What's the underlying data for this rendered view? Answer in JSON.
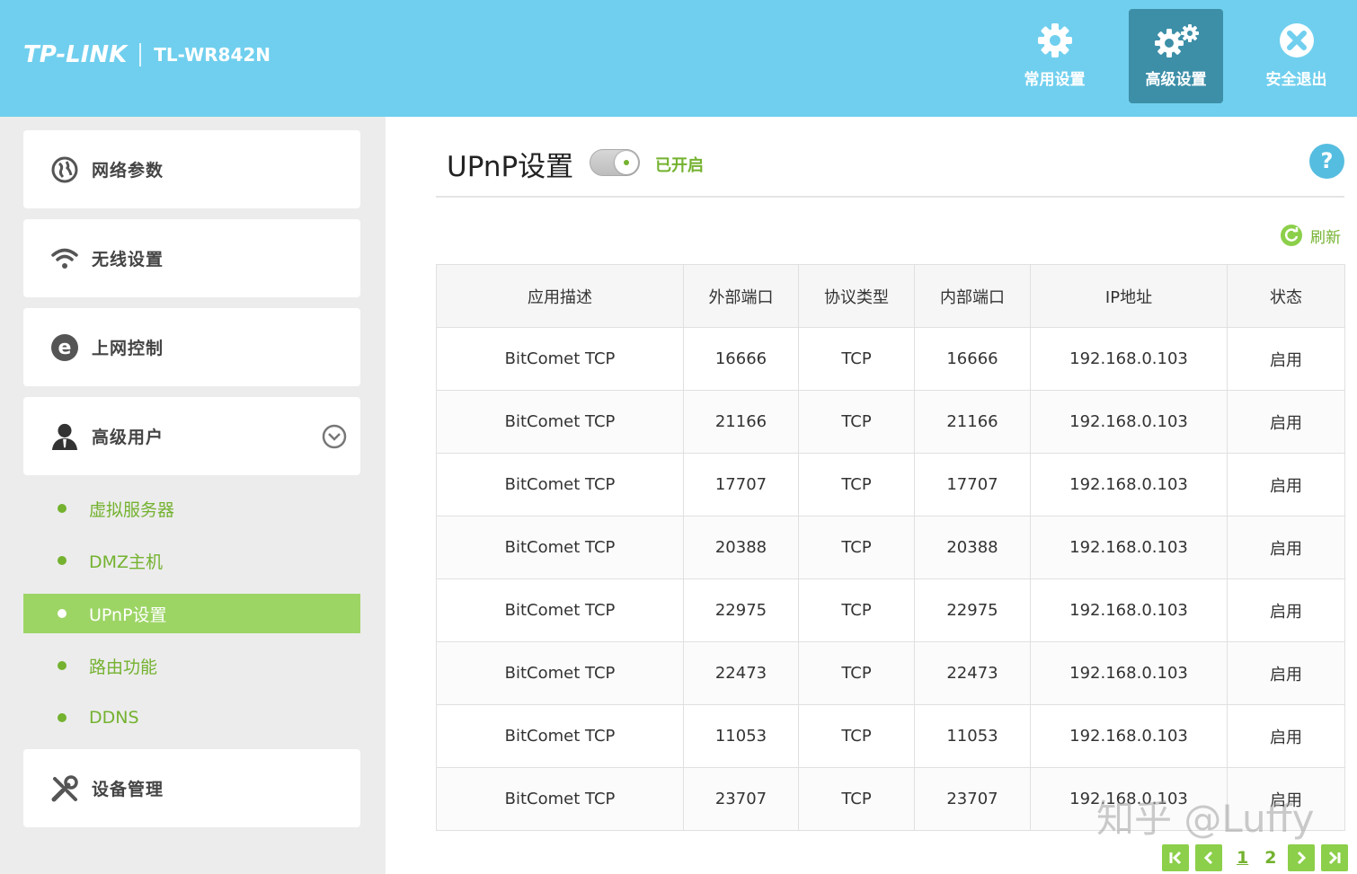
{
  "header": {
    "brand": "TP-LINK",
    "model": "TL-WR842N",
    "nav": [
      {
        "label": "常用设置",
        "icon": "gear-icon"
      },
      {
        "label": "高级设置",
        "icon": "gears-icon",
        "active": true
      },
      {
        "label": "安全退出",
        "icon": "close-circle-icon"
      }
    ]
  },
  "sidebar": {
    "menus": [
      {
        "label": "网络参数",
        "icon": "globe-icon"
      },
      {
        "label": "无线设置",
        "icon": "wifi-icon"
      },
      {
        "label": "上网控制",
        "icon": "ie-icon"
      },
      {
        "label": "高级用户",
        "icon": "user-icon"
      },
      {
        "label": "设备管理",
        "icon": "tools-icon"
      }
    ],
    "subitems": [
      {
        "label": "虚拟服务器"
      },
      {
        "label": "DMZ主机"
      },
      {
        "label": "UPnP设置",
        "active": true
      },
      {
        "label": "路由功能"
      },
      {
        "label": "DDNS"
      }
    ]
  },
  "main": {
    "title": "UPnP设置",
    "toggle_state": "已开启",
    "help": "?",
    "refresh": "刷新",
    "table": {
      "headers": [
        "应用描述",
        "外部端口",
        "协议类型",
        "内部端口",
        "IP地址",
        "状态"
      ],
      "rows": [
        [
          "BitComet TCP",
          "16666",
          "TCP",
          "16666",
          "192.168.0.103",
          "启用"
        ],
        [
          "BitComet TCP",
          "21166",
          "TCP",
          "21166",
          "192.168.0.103",
          "启用"
        ],
        [
          "BitComet TCP",
          "17707",
          "TCP",
          "17707",
          "192.168.0.103",
          "启用"
        ],
        [
          "BitComet TCP",
          "20388",
          "TCP",
          "20388",
          "192.168.0.103",
          "启用"
        ],
        [
          "BitComet TCP",
          "22975",
          "TCP",
          "22975",
          "192.168.0.103",
          "启用"
        ],
        [
          "BitComet TCP",
          "22473",
          "TCP",
          "22473",
          "192.168.0.103",
          "启用"
        ],
        [
          "BitComet TCP",
          "11053",
          "TCP",
          "11053",
          "192.168.0.103",
          "启用"
        ],
        [
          "BitComet TCP",
          "23707",
          "TCP",
          "23707",
          "192.168.0.103",
          "启用"
        ]
      ]
    },
    "pager": {
      "pages": [
        "1",
        "2"
      ],
      "current": "1"
    }
  },
  "watermark": "知乎 @Luffy",
  "colors": {
    "header": "#70cfee",
    "active_nav": "#3d8fa8",
    "accent_green": "#74b22f",
    "active_sub": "#9dd565"
  }
}
